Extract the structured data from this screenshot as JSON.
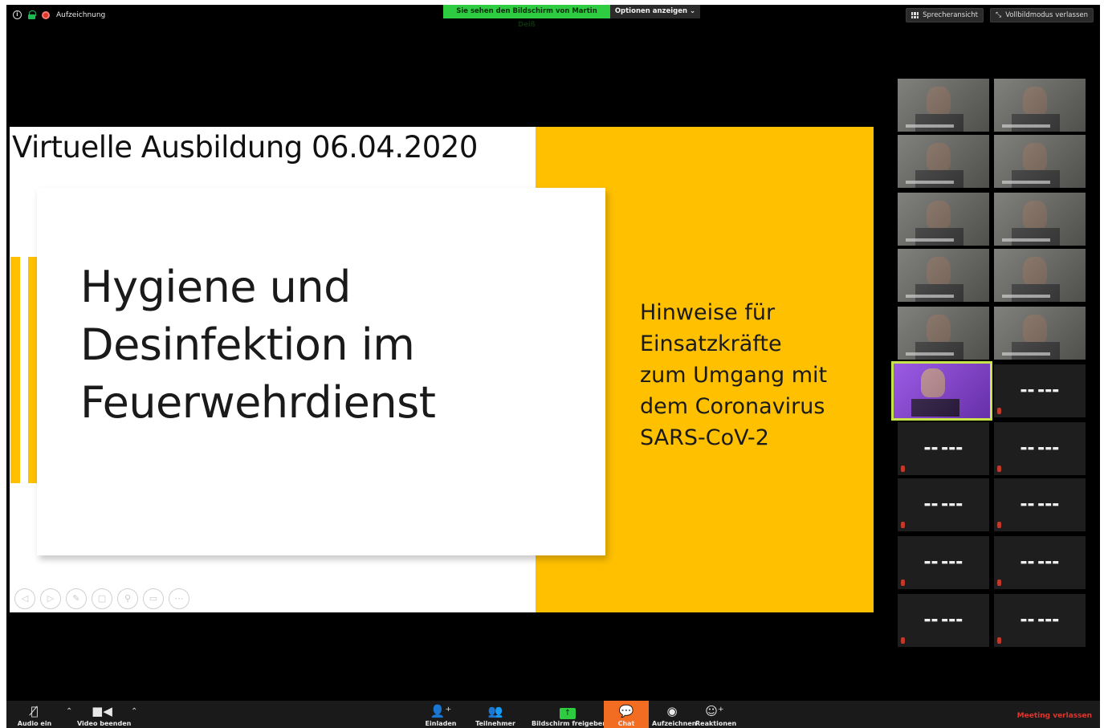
{
  "topbar": {
    "recording_label": "Aufzeichnung",
    "share_banner": "Sie sehen den Bildschirm von Martin Deiß",
    "options_label": "Optionen anzeigen ⌄",
    "speaker_view_label": "Sprecheransicht",
    "exit_fullscreen_label": "Vollbildmodus verlassen"
  },
  "slide": {
    "title": "Virtuelle Ausbildung 06.04.2020",
    "main_title_lines": [
      "Hygiene und",
      "Desinfektion im",
      "Feuerwehrdienst"
    ],
    "side_text_lines": [
      "Hinweise für",
      "Einsatzkräfte",
      "zum Umgang mit",
      "dem Coronavirus",
      "SARS-CoV-2"
    ],
    "controls": [
      "◁",
      "▷",
      "✎",
      "▢",
      "⚲",
      "▭",
      "⋯"
    ]
  },
  "gallery": {
    "participants": [
      {
        "type": "video"
      },
      {
        "type": "video"
      },
      {
        "type": "video"
      },
      {
        "type": "video"
      },
      {
        "type": "video"
      },
      {
        "type": "video"
      },
      {
        "type": "video"
      },
      {
        "type": "video"
      },
      {
        "type": "video"
      },
      {
        "type": "video"
      },
      {
        "type": "video",
        "active": true
      },
      {
        "type": "name"
      },
      {
        "type": "name"
      },
      {
        "type": "name"
      },
      {
        "type": "name"
      },
      {
        "type": "name"
      },
      {
        "type": "name"
      },
      {
        "type": "name"
      },
      {
        "type": "name"
      },
      {
        "type": "name"
      }
    ]
  },
  "toolbar": {
    "audio_label": "Audio ein",
    "video_label": "Video beenden",
    "invite_label": "Einladen",
    "participants_label": "Teilnehmer",
    "share_label": "Bildschirm freigeben",
    "chat_label": "Chat",
    "record_label": "Aufzeichnen",
    "reactions_label": "Reaktionen",
    "leave_label": "Meeting verlassen"
  },
  "colors": {
    "slide_accent": "#ffc000",
    "share_green": "#2ecc40",
    "chat_orange": "#f26d21",
    "leave_red": "#e0352c",
    "active_speaker_border": "#c7e54a"
  }
}
